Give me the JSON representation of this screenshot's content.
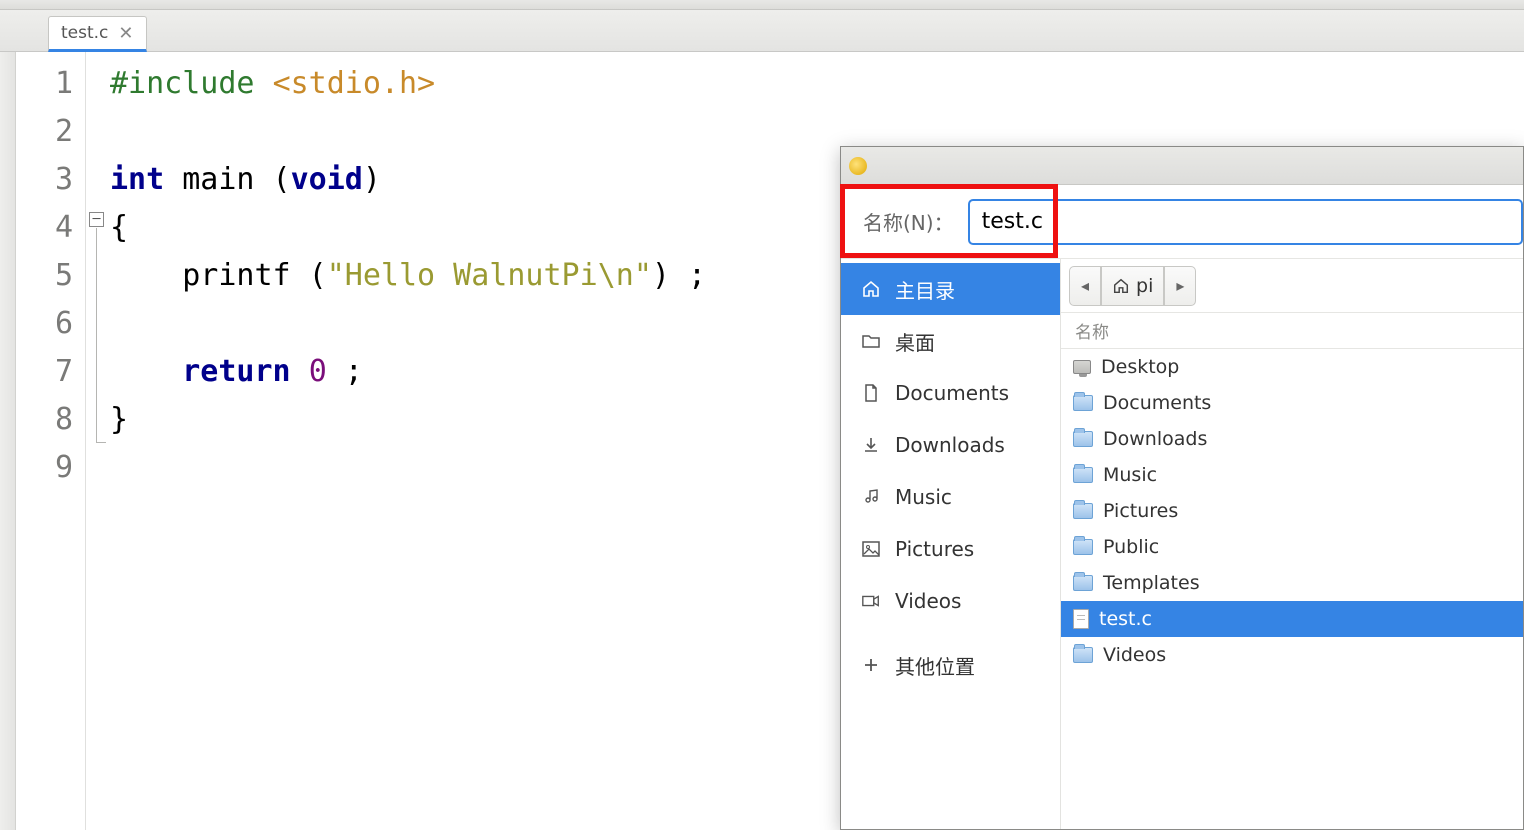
{
  "editor": {
    "tab": {
      "filename": "test.c"
    },
    "lines": [
      "1",
      "2",
      "3",
      "4",
      "5",
      "6",
      "7",
      "8",
      "9"
    ],
    "code": {
      "l1a": "#include",
      "l1b": "<stdio.h>",
      "l3_int": "int",
      "l3_main": " main (",
      "l3_void": "void",
      "l3_close": ")",
      "l4": "{",
      "l5a": "    printf (",
      "l5b": "\"Hello WalnutPi",
      "l5c": "\\n",
      "l5d": "\"",
      "l5e": ") ;",
      "l7a": "    ",
      "l7b": "return",
      "l7c": " ",
      "l7d": "0",
      "l7e": " ;",
      "l8": "}"
    }
  },
  "dialog": {
    "name_label": "名称(N)：",
    "filename_value": "test.c",
    "places": [
      {
        "id": "home",
        "label": "主目录",
        "icon": "home",
        "selected": true
      },
      {
        "id": "desktop",
        "label": "桌面",
        "icon": "folder"
      },
      {
        "id": "documents",
        "label": "Documents",
        "icon": "document"
      },
      {
        "id": "downloads",
        "label": "Downloads",
        "icon": "download"
      },
      {
        "id": "music",
        "label": "Music",
        "icon": "music"
      },
      {
        "id": "pictures",
        "label": "Pictures",
        "icon": "picture"
      },
      {
        "id": "videos",
        "label": "Videos",
        "icon": "video"
      },
      {
        "id": "other",
        "label": "其他位置",
        "icon": "plus"
      }
    ],
    "path": {
      "back_arrow": "◂",
      "home_label": "pi",
      "fwd_arrow": "▸"
    },
    "files_header": "名称",
    "files": [
      {
        "name": "Desktop",
        "type": "desktop"
      },
      {
        "name": "Documents",
        "type": "folder"
      },
      {
        "name": "Downloads",
        "type": "folder"
      },
      {
        "name": "Music",
        "type": "folder"
      },
      {
        "name": "Pictures",
        "type": "folder"
      },
      {
        "name": "Public",
        "type": "folder"
      },
      {
        "name": "Templates",
        "type": "folder"
      },
      {
        "name": "test.c",
        "type": "file",
        "selected": true
      },
      {
        "name": "Videos",
        "type": "folder"
      }
    ]
  }
}
